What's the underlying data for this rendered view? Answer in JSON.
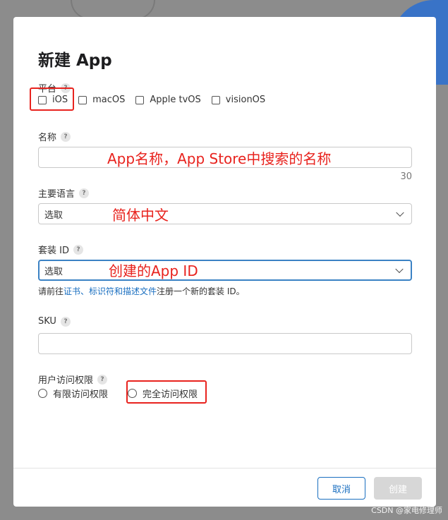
{
  "dialog": {
    "title": "新建 App",
    "platform_label": "平台",
    "help_glyph": "?",
    "platforms": [
      "iOS",
      "macOS",
      "Apple tvOS",
      "visionOS"
    ],
    "name_label": "名称",
    "name_value": "",
    "name_counter": "30",
    "language_label": "主要语言",
    "language_select": "选取",
    "bundle_label": "套装 ID",
    "bundle_select": "选取",
    "bundle_hint_prefix": "请前往",
    "bundle_hint_link": "证书、标识符和描述文件",
    "bundle_hint_suffix": "注册一个新的套装 ID。",
    "sku_label": "SKU",
    "sku_value": "",
    "access_label": "用户访问权限",
    "access_options": [
      "有限访问权限",
      "完全访问权限"
    ],
    "cancel_label": "取消",
    "create_label": "创建"
  },
  "annotations": {
    "name_note": "App名称，App Store中搜索的名称",
    "language_note": "简体中文",
    "bundle_note": "创建的App ID"
  },
  "watermark": "CSDN @家电修理师",
  "colors": {
    "accent": "#1a6fc0",
    "annotation": "#e8231e",
    "disabled_button": "#d7d7d7"
  }
}
